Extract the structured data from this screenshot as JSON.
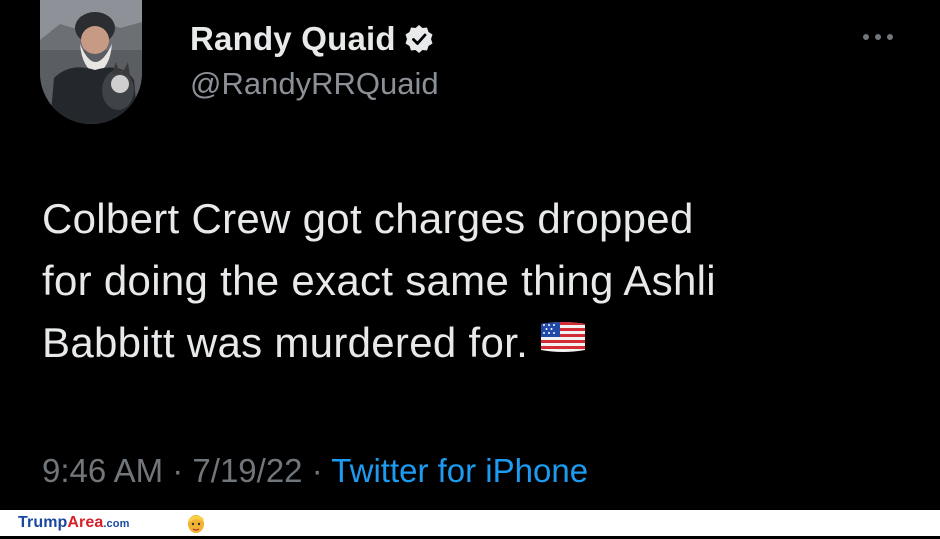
{
  "tweet": {
    "author_name": "Randy Quaid",
    "handle": "@RandyRRQuaid",
    "text_lines": [
      "Colbert Crew got charges dropped",
      "for doing the exact same thing Ashli",
      "Babbitt was murdered for."
    ],
    "flag_icon": "us-flag-emoji",
    "time": "9:46 AM",
    "date": "7/19/22",
    "separator": "·",
    "source": "Twitter for iPhone"
  },
  "watermark": {
    "part1": "Trump",
    "part2": "Area",
    "part3": ".com"
  },
  "colors": {
    "background": "#000000",
    "text": "#e7e9ea",
    "muted": "#71767b",
    "link": "#1d9bf0"
  }
}
